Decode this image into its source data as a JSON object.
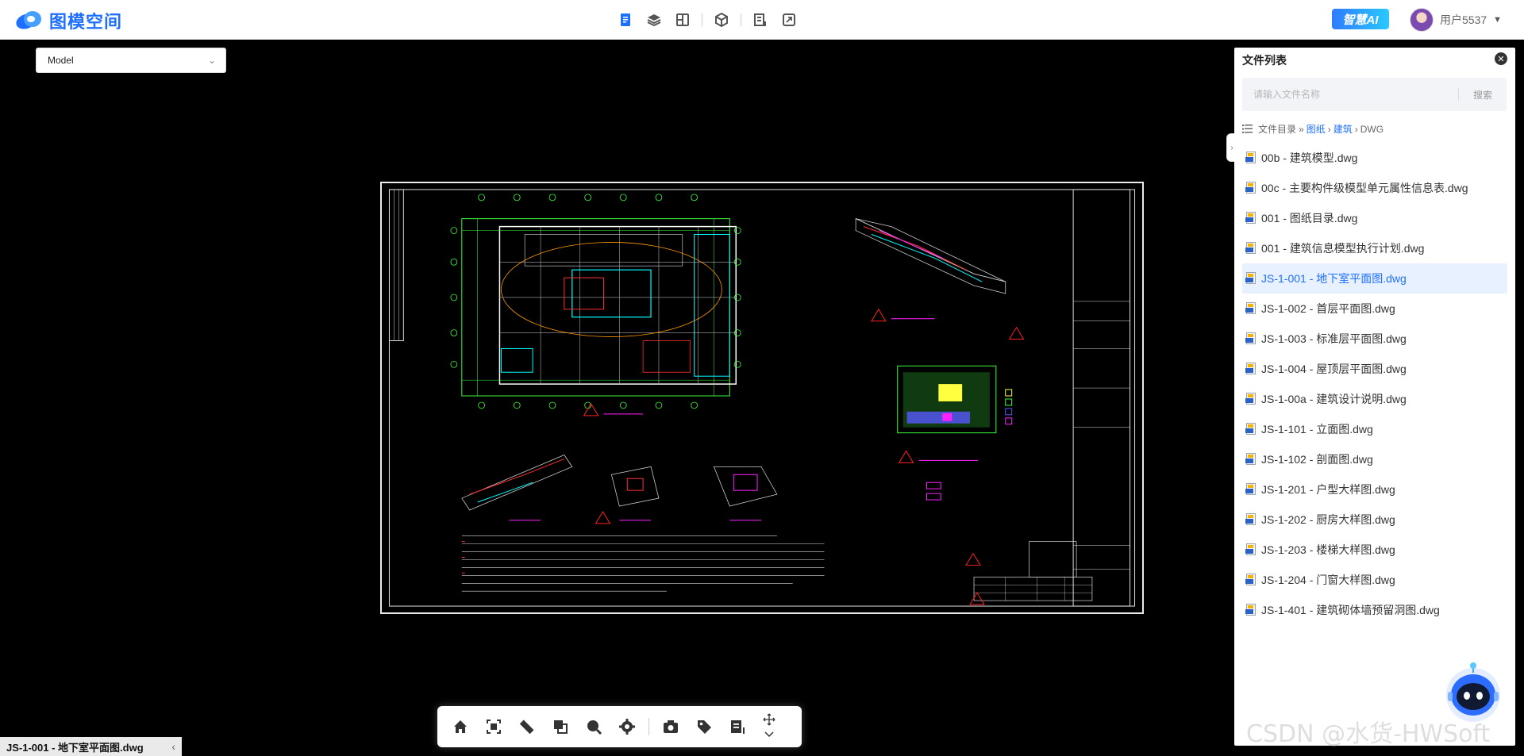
{
  "header": {
    "logo_text": "图模空间",
    "ai_badge": "智慧AI",
    "user_name": "用户5537",
    "toolbar_icons": [
      "document-icon",
      "layers-icon",
      "layout-icon",
      "package-icon",
      "list-icon",
      "fullscreen-icon"
    ]
  },
  "viewer": {
    "model_select": "Model",
    "active_file_tab": "JS-1-001 - 地下室平面图.dwg"
  },
  "bottom_toolbar": {
    "icons": [
      "home-icon",
      "fit-view-icon",
      "measure-ruler-icon",
      "compare-icon",
      "search-zoom-icon",
      "settings-icon",
      "camera-icon",
      "tag-icon",
      "list-icon",
      "move-icon",
      "chevron-down-icon"
    ]
  },
  "panel": {
    "title": "文件列表",
    "search_placeholder": "请输入文件名称",
    "search_button": "搜索",
    "breadcrumb": {
      "root": "文件目录",
      "items": [
        "图纸",
        "建筑",
        "DWG"
      ]
    },
    "files": [
      {
        "name": "00b - 建筑模型.dwg",
        "active": false
      },
      {
        "name": "00c - 主要构件级模型单元属性信息表.dwg",
        "active": false
      },
      {
        "name": "001 - 图纸目录.dwg",
        "active": false
      },
      {
        "name": "001 - 建筑信息模型执行计划.dwg",
        "active": false
      },
      {
        "name": "JS-1-001 - 地下室平面图.dwg",
        "active": true
      },
      {
        "name": "JS-1-002 - 首层平面图.dwg",
        "active": false
      },
      {
        "name": "JS-1-003 - 标准层平面图.dwg",
        "active": false
      },
      {
        "name": "JS-1-004 - 屋顶层平面图.dwg",
        "active": false
      },
      {
        "name": "JS-1-00a - 建筑设计说明.dwg",
        "active": false
      },
      {
        "name": "JS-1-101 - 立面图.dwg",
        "active": false
      },
      {
        "name": "JS-1-102 - 剖面图.dwg",
        "active": false
      },
      {
        "name": "JS-1-201 - 户型大样图.dwg",
        "active": false
      },
      {
        "name": "JS-1-202 - 厨房大样图.dwg",
        "active": false
      },
      {
        "name": "JS-1-203 - 楼梯大样图.dwg",
        "active": false
      },
      {
        "name": "JS-1-204 - 门窗大样图.dwg",
        "active": false
      },
      {
        "name": "JS-1-401 - 建筑砌体墙预留洞图.dwg",
        "active": false
      }
    ]
  },
  "watermark": "CSDN @水货-HWSoft",
  "colors": {
    "accent": "#1e6fff",
    "active_row_bg": "#e8f1ff"
  }
}
